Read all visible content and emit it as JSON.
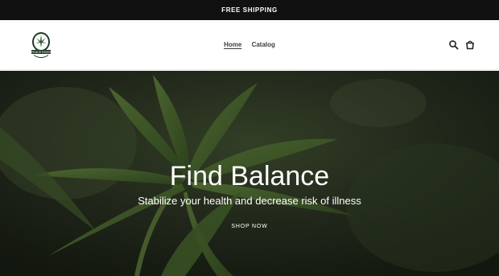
{
  "announcement": {
    "text": "FREE SHIPPING"
  },
  "header": {
    "logo_alt": "Peace River",
    "nav": [
      {
        "label": "Home"
      },
      {
        "label": "Catalog"
      }
    ],
    "icons": {
      "search": "search-icon",
      "cart": "cart-icon"
    }
  },
  "hero": {
    "title": "Find Balance",
    "subtitle": "Stabilize your health and decrease risk of illness",
    "cta": "SHOP NOW"
  },
  "colors": {
    "announcement_bg": "#111111",
    "header_bg": "#ffffff",
    "nav_text": "#3d3d3d",
    "hero_overlay": "#1d2317",
    "leaf_green": "#5e7f3c"
  }
}
